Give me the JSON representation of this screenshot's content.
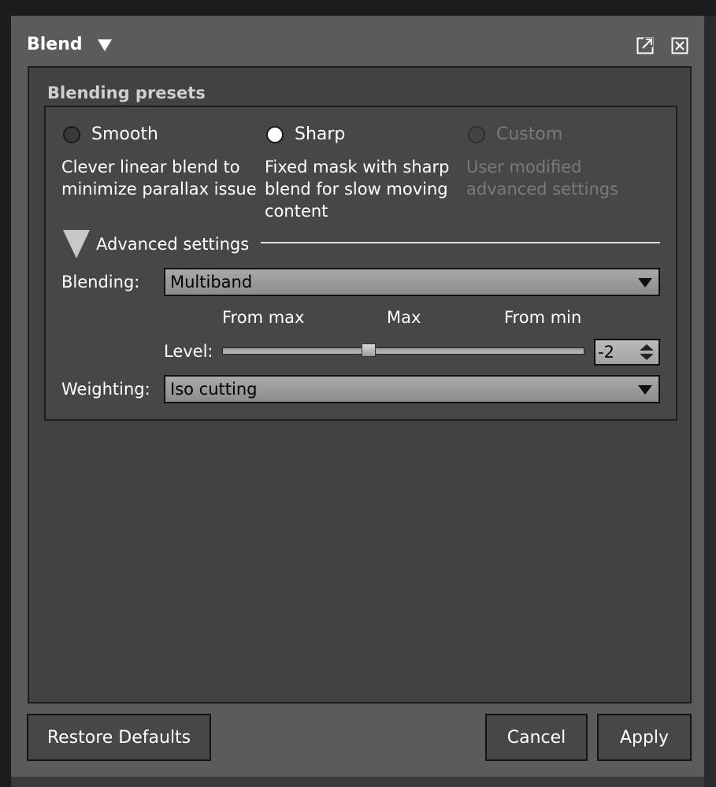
{
  "window": {
    "title": "Blend"
  },
  "presets": {
    "group_title": "Blending presets",
    "options": [
      {
        "label": "Smooth",
        "description_line1": "Clever linear blend to",
        "description_line2": "minimize parallax issue",
        "description_line3": "",
        "state": "unchecked"
      },
      {
        "label": "Sharp",
        "description_line1": "Fixed mask with sharp",
        "description_line2": "blend for slow moving",
        "description_line3": "content",
        "state": "checked"
      },
      {
        "label": "Custom",
        "description_line1": "User modified",
        "description_line2": "advanced settings",
        "description_line3": "",
        "state": "disabled"
      }
    ]
  },
  "advanced": {
    "label": "Advanced settings",
    "blending_label": "Blending:",
    "blending_value": "Multiband",
    "tick_from_max": "From max",
    "tick_max": "Max",
    "tick_from_min": "From min",
    "level_label": "Level:",
    "level_value": "-2",
    "level_slider_fraction": 0.4,
    "weighting_label": "Weighting:",
    "weighting_value": "Iso cutting"
  },
  "buttons": {
    "restore": "Restore Defaults",
    "cancel": "Cancel",
    "apply": "Apply"
  },
  "icons": {
    "detach": "external-link-icon",
    "close": "close-box-icon"
  }
}
